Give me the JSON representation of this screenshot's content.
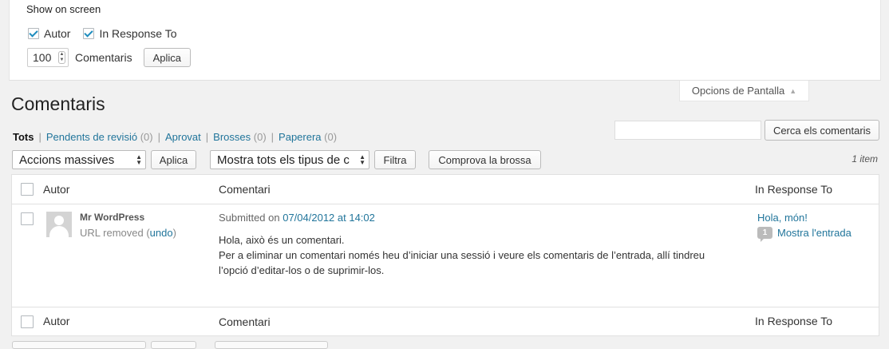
{
  "screen_options": {
    "title": "Show on screen",
    "columns": [
      {
        "label": "Autor",
        "checked": true
      },
      {
        "label": "In Response To",
        "checked": true
      }
    ],
    "per_page_value": "100",
    "per_page_label": "Comentaris",
    "apply_label": "Aplica",
    "tab_label": "Opcions de Pantalla"
  },
  "page_title": "Comentaris",
  "filters": {
    "all": "Tots",
    "pending": "Pendents de revisió",
    "pending_count": "(0)",
    "approved": "Aprovat",
    "spam": "Brosses",
    "spam_count": "(0)",
    "trash": "Paperera",
    "trash_count": "(0)"
  },
  "search": {
    "placeholder": "",
    "button": "Cerca els comentaris"
  },
  "tablenav": {
    "bulk_actions": "Accions massives",
    "apply": "Aplica",
    "type_filter": "Mostra tots els tipus de c",
    "filter_button": "Filtra",
    "check_spam": "Comprova la brossa",
    "items": "1 item"
  },
  "table": {
    "columns": {
      "author": "Autor",
      "comment": "Comentari",
      "response": "In Response To"
    },
    "rows": [
      {
        "author_name": "Mr WordPress",
        "url_removed": "URL removed (",
        "undo": "undo",
        "url_close": ")",
        "submitted_prefix": "Submitted on ",
        "submitted_date": "07/04/2012 at 14:02",
        "text_line1": "Hola, això és un comentari.",
        "text_line2": "Per a eliminar un comentari només heu d’iniciar una sessió i veure els comentaris de l’entrada, allí tindreu l’opció d’editar-los o de suprimir-los.",
        "post_title": "Hola, món!",
        "comment_count": "1",
        "view_post": "Mostra l'entrada"
      }
    ]
  }
}
